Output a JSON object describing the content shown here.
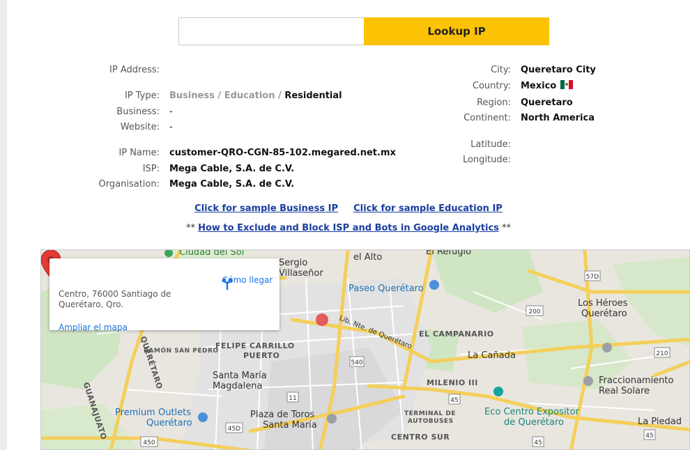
{
  "lookup": {
    "input_value": "",
    "button_label": "Lookup IP"
  },
  "left_fields": [
    {
      "label": "IP Address:",
      "value": ""
    },
    {
      "label": "IP Type:",
      "value": ""
    },
    {
      "label": "Business:",
      "value": "-"
    },
    {
      "label": "Website:",
      "value": "-"
    },
    {
      "label": "IP Name:",
      "value": "customer-QRO-CGN-85-102.megared.net.mx"
    },
    {
      "label": "ISP:",
      "value": "Mega Cable, S.A. de C.V."
    },
    {
      "label": "Organisation:",
      "value": "Mega Cable, S.A. de C.V."
    }
  ],
  "ip_type": {
    "option1": "Business",
    "sep1": " / ",
    "option2": "Education",
    "sep2": " / ",
    "selected": "Residential"
  },
  "right_fields": [
    {
      "label": "City:",
      "value": "Queretaro City"
    },
    {
      "label": "Country:",
      "value": "Mexico"
    },
    {
      "label": "Region:",
      "value": "Queretaro"
    },
    {
      "label": "Continent:",
      "value": "North America"
    },
    {
      "label": "Latitude:",
      "value": ""
    },
    {
      "label": "Longitude:",
      "value": ""
    }
  ],
  "links": {
    "sample_business": "Click for sample Business IP",
    "sample_education": "Click for sample Education IP",
    "prefix": "** ",
    "exclude": "How to Exclude and Block ISP and Bots in Google Analytics",
    "suffix": " **"
  },
  "map": {
    "card": {
      "address": "Centro, 76000 Santiago de Querétaro, Qro.",
      "directions": "Cómo llegar",
      "enlarge": "Ampliar el mapa"
    },
    "labels": {
      "ciudad_del_sol": "Ciudad del Sol",
      "sergio": "Sergio",
      "villasenor": "Villaseñor",
      "ignacio_alto": "el Alto",
      "el_refugio": "El Refugio",
      "paseo": "Paseo Querétaro",
      "libnte": "Lib. Nte. de Querétaro",
      "campanario": "EL CAMPANARIO",
      "heroes1": "Los Héroes",
      "heroes2": "Querétaro",
      "felipe1": "FELIPE CARRILLO",
      "felipe2": "PUERTO",
      "ramon": "RAMÓN SAN PEDRO",
      "canada": "La Cañada",
      "santa_maria1": "Santa María",
      "santa_maria2": "Magdalena",
      "milenio": "MILENIO III",
      "fracc1": "Fraccionamiento",
      "fracc2": "Real Solare",
      "premium1": "Premium Outlets",
      "premium2": "Querétaro",
      "plaza1": "Plaza de Toros",
      "plaza2": "Santa María",
      "terminal1": "TERMINAL DE",
      "terminal2": "AUTOBUSES",
      "eco1": "Eco Centro Expositor",
      "eco2": "de Querétaro",
      "centro_sur": "CENTRO SUR",
      "la_piedad": "La Piedad",
      "guanajuato": "GUANAJUATO",
      "queretaro_v": "QUERÉTARO"
    },
    "shields": [
      "540",
      "11",
      "45",
      "57D",
      "200",
      "210",
      "45D",
      "450",
      "45",
      "45"
    ]
  }
}
